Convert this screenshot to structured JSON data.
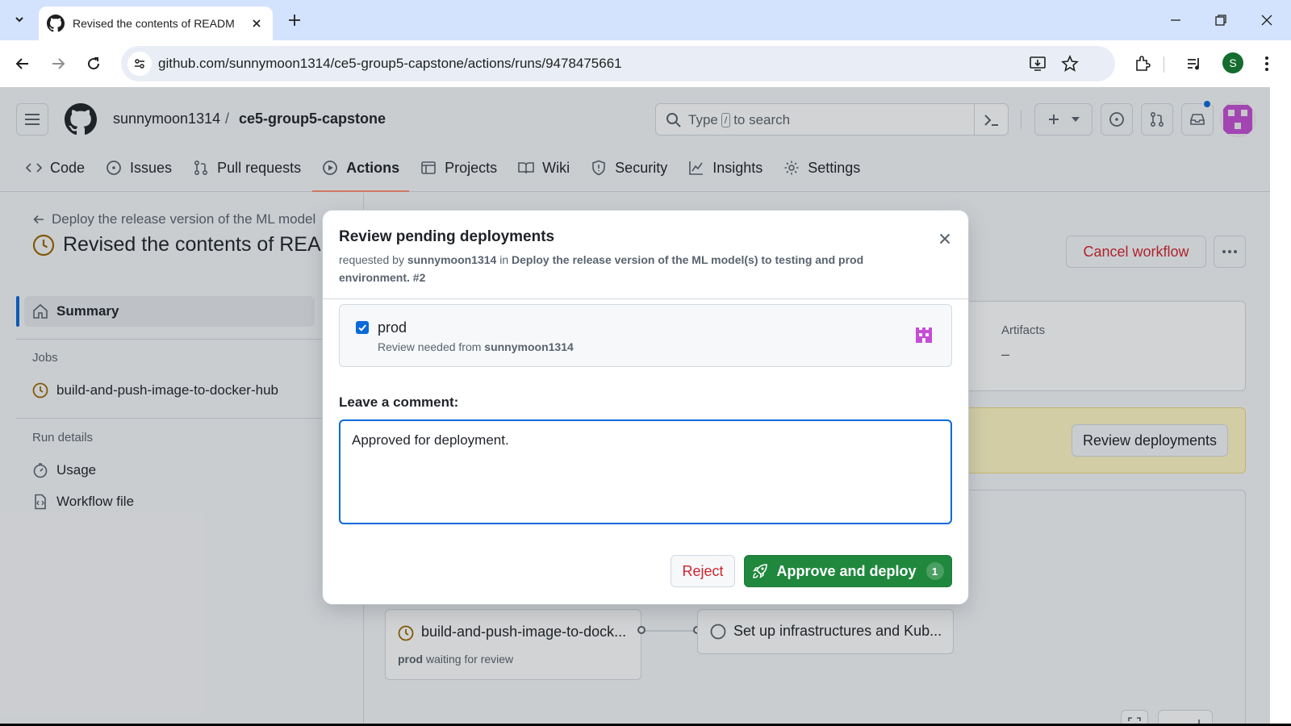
{
  "browser": {
    "tab_title": "Revised the contents of READM",
    "url": "github.com/sunnymoon1314/ce5-group5-capstone/actions/runs/9478475661",
    "profile_initial": "S"
  },
  "github": {
    "owner": "sunnymoon1314",
    "separator": "/",
    "repo": "ce5-group5-capstone",
    "search_before": "Type",
    "search_key": "/",
    "search_after": "to search",
    "tabs": [
      {
        "label": "Code",
        "icon": "code-icon"
      },
      {
        "label": "Issues",
        "icon": "issue-icon"
      },
      {
        "label": "Pull requests",
        "icon": "pull-request-icon"
      },
      {
        "label": "Actions",
        "icon": "play-icon"
      },
      {
        "label": "Projects",
        "icon": "table-icon"
      },
      {
        "label": "Wiki",
        "icon": "book-icon"
      },
      {
        "label": "Security",
        "icon": "shield-icon"
      },
      {
        "label": "Insights",
        "icon": "graph-icon"
      },
      {
        "label": "Settings",
        "icon": "gear-icon"
      }
    ],
    "active_tab": "Actions"
  },
  "run": {
    "back_link": "Deploy the release version of the ML model",
    "title": "Revised the contents of REAI",
    "cancel_label": "Cancel workflow"
  },
  "sidebar": {
    "summary": "Summary",
    "jobs_heading": "Jobs",
    "job_name": "build-and-push-image-to-docker-hub",
    "run_details_heading": "Run details",
    "usage": "Usage",
    "workflow_file": "Workflow file"
  },
  "summary_card": {
    "artifacts_label": "Artifacts",
    "artifacts_value": "–"
  },
  "banner": {
    "review_label": "Review deployments"
  },
  "graph": {
    "job1_title": "build-and-push-image-to-dock...",
    "job1_env": "prod",
    "job1_status": "waiting for review",
    "job2_title": "Set up infrastructures and Kub..."
  },
  "dialog": {
    "title": "Review pending deployments",
    "requested_by_prefix": "requested by",
    "requester": "sunnymoon1314",
    "in_word": "in",
    "workflow": "Deploy the release version of the ML model(s) to testing and prod environment.",
    "run_number": "#2",
    "environment": {
      "name": "prod",
      "checked": true,
      "review_prefix": "Review needed from",
      "reviewer": "sunnymoon1314"
    },
    "comment_label": "Leave a comment:",
    "comment_value": "Approved for deployment.",
    "reject_label": "Reject",
    "approve_label": "Approve and deploy",
    "approve_count": "1"
  },
  "colors": {
    "accent": "#0969da",
    "approve": "#1f883d",
    "danger": "#d1242f",
    "pending": "#9a6700",
    "banner_bg": "#fff8c5"
  }
}
